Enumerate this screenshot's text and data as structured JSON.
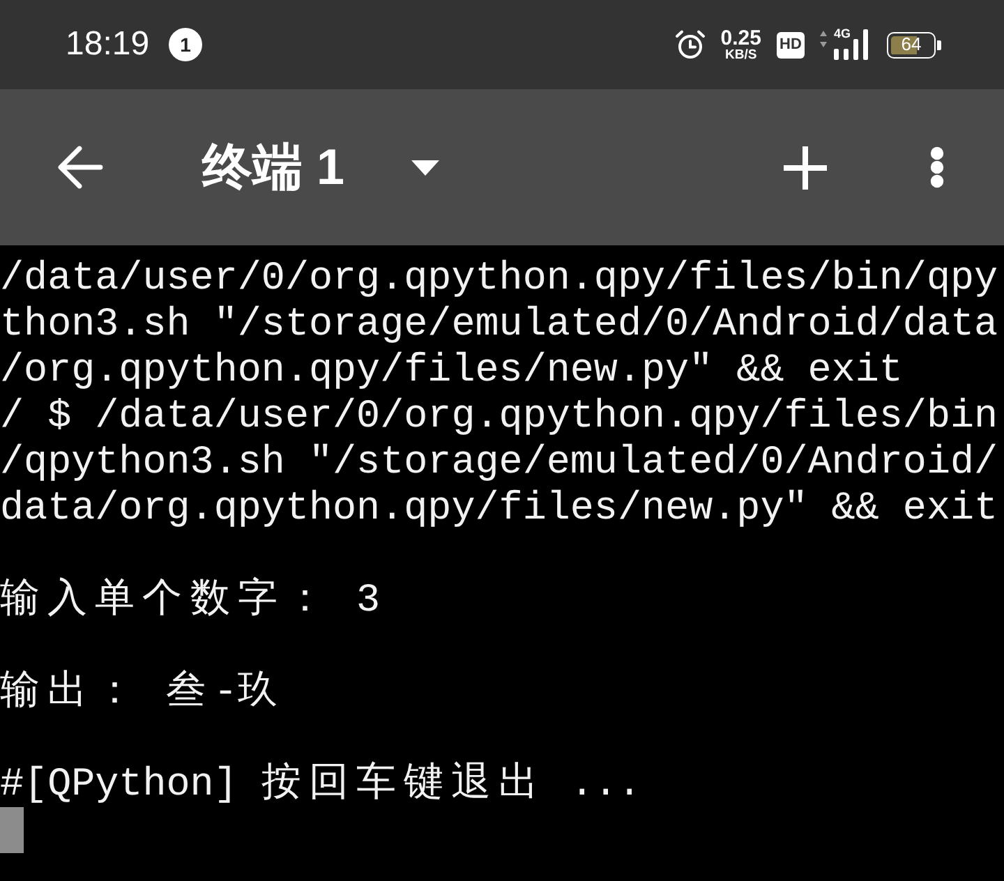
{
  "status_bar": {
    "time": "18:19",
    "notification_count": "1",
    "net_speed": "0.25",
    "net_speed_unit": "KB/S",
    "hd_label": "HD",
    "network_type": "4G",
    "battery": "64"
  },
  "toolbar": {
    "title": "终端 1"
  },
  "terminal": {
    "lines": [
      {
        "kind": "text",
        "text": "/data/user/0/org.qpython.qpy/files/bin/qpy"
      },
      {
        "kind": "text",
        "text": "thon3.sh \"/storage/emulated/0/Android/data"
      },
      {
        "kind": "text",
        "text": "/org.qpython.qpy/files/new.py\" && exit"
      },
      {
        "kind": "text",
        "text": "/ $ /data/user/0/org.qpython.qpy/files/bin"
      },
      {
        "kind": "text",
        "text": "/qpython3.sh \"/storage/emulated/0/Android/"
      },
      {
        "kind": "text",
        "text": "data/org.qpython.qpy/files/new.py\" && exit"
      },
      {
        "kind": "blank"
      },
      {
        "kind": "text",
        "text": "输入单个数字： 3"
      },
      {
        "kind": "blank"
      },
      {
        "kind": "text",
        "text": "输出： 叁-玖"
      },
      {
        "kind": "blank"
      },
      {
        "kind": "text",
        "text": "#[QPython] 按回车键退出 ..."
      },
      {
        "kind": "cursor"
      }
    ]
  }
}
